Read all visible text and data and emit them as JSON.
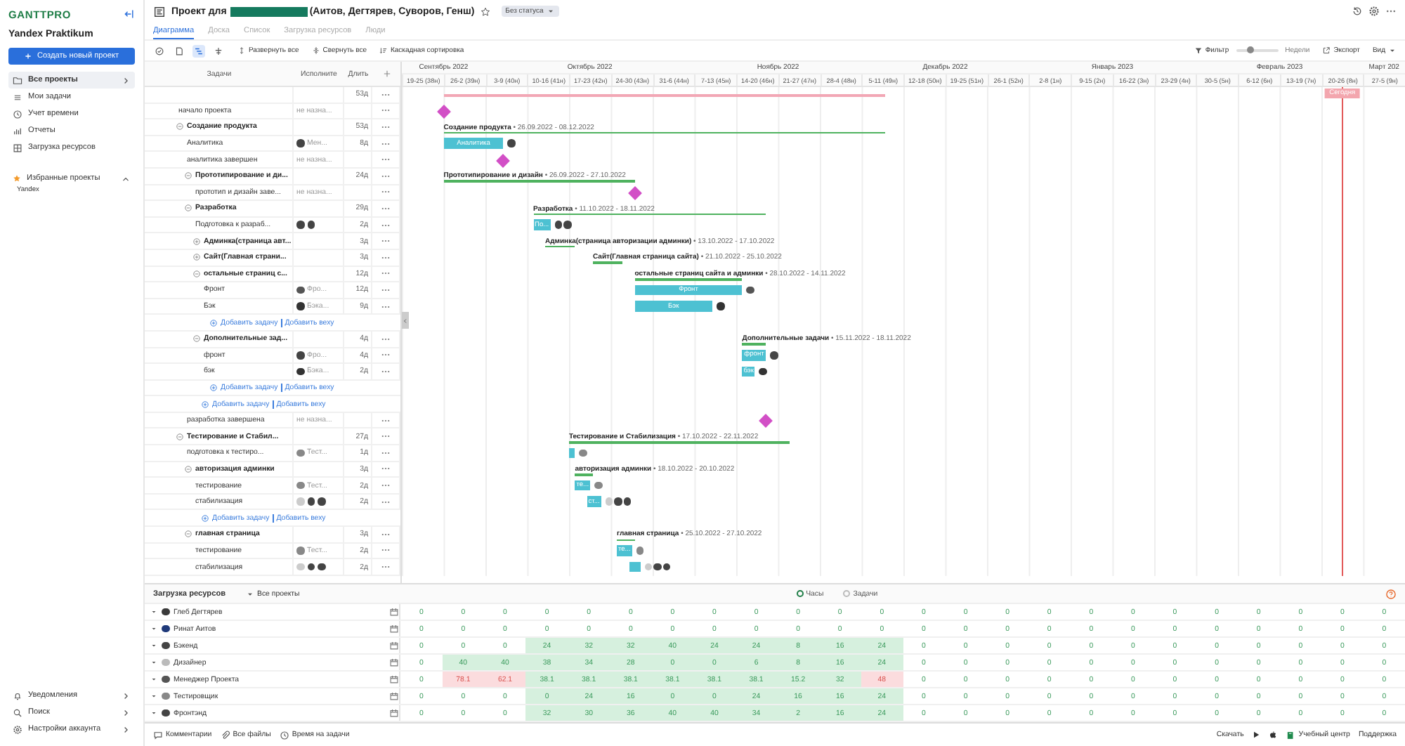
{
  "sidebar": {
    "logo": "GANTTPRO",
    "workspace": "Yandex Praktikum",
    "create_button": "Создать новый проект",
    "nav": [
      {
        "kind": "folder",
        "label": "Все проекты",
        "selected": true
      },
      {
        "kind": "list",
        "label": "Мои задачи",
        "selected": false
      },
      {
        "kind": "clock",
        "label": "Учет времени",
        "selected": false
      },
      {
        "kind": "chart",
        "label": "Отчеты",
        "selected": false
      },
      {
        "kind": "grid",
        "label": "Загрузка ресурсов",
        "selected": false
      }
    ],
    "favorites": {
      "title": "Избранные проекты",
      "expanded": true,
      "items": [
        "Yandex"
      ]
    },
    "bottom": [
      {
        "kind": "bell",
        "label": "Уведомления"
      },
      {
        "kind": "search",
        "label": "Поиск"
      },
      {
        "kind": "gear",
        "label": "Настройки аккаунта"
      }
    ]
  },
  "topbar": {
    "title_prefix": "Проект для",
    "title_suffix": "(Аитов, Дегтярев, Суворов, Генш)",
    "status": "Без статуса"
  },
  "tabs": [
    {
      "label": "Диаграмма",
      "selected": true
    },
    {
      "label": "Доска",
      "selected": false
    },
    {
      "label": "Список",
      "selected": false
    },
    {
      "label": "Загрузка ресурсов",
      "selected": false
    },
    {
      "label": "Люди",
      "selected": false
    }
  ],
  "toolbar": {
    "toggles": [
      {
        "kind": "check",
        "on": false
      },
      {
        "kind": "doc",
        "on": false
      },
      {
        "kind": "gantt",
        "on": true
      },
      {
        "kind": "split",
        "on": false
      }
    ],
    "actions": [
      {
        "kind": "expand",
        "label": "Развернуть все"
      },
      {
        "kind": "collapse",
        "label": "Свернуть все"
      },
      {
        "kind": "sort",
        "label": "Каскадная сортировка"
      }
    ],
    "filter": "Фильтр",
    "zoom": {
      "level": 0.35,
      "label": "Недели"
    },
    "export": "Экспорт",
    "view": "Вид"
  },
  "grid": {
    "columns": [
      "Задачи",
      "Исполните",
      "Длить"
    ]
  },
  "timeline": {
    "months": [
      {
        "label": "Сентябрь 2022",
        "weeks": [
          {
            "label": "19-25 (38н)",
            "today": false
          },
          {
            "label": "26-2 (39н)",
            "today": false
          }
        ]
      },
      {
        "label": "Октябрь 2022",
        "weeks": [
          {
            "label": "3-9 (40н)",
            "today": false
          },
          {
            "label": "10-16 (41н)",
            "today": false
          },
          {
            "label": "17-23 (42н)",
            "today": false
          },
          {
            "label": "24-30 (43н)",
            "today": false
          },
          {
            "label": "31-6 (44н)",
            "today": false
          }
        ]
      },
      {
        "label": "Ноябрь 2022",
        "weeks": [
          {
            "label": "7-13 (45н)",
            "today": false
          },
          {
            "label": "14-20 (46н)",
            "today": false
          },
          {
            "label": "21-27 (47н)",
            "today": false
          },
          {
            "label": "28-4 (48н)",
            "today": false
          }
        ]
      },
      {
        "label": "Декабрь 2022",
        "weeks": [
          {
            "label": "5-11 (49н)",
            "today": false
          },
          {
            "label": "12-18 (50н)",
            "today": false
          },
          {
            "label": "19-25 (51н)",
            "today": false
          },
          {
            "label": "26-1 (52н)",
            "today": false
          }
        ]
      },
      {
        "label": "Январь 2023",
        "weeks": [
          {
            "label": "2-8 (1н)",
            "today": false
          },
          {
            "label": "9-15 (2н)",
            "today": false
          },
          {
            "label": "16-22 (3н)",
            "today": false
          },
          {
            "label": "23-29 (4н)",
            "today": false
          }
        ]
      },
      {
        "label": "Февраль 2023",
        "weeks": [
          {
            "label": "30-5 (5н)",
            "today": false
          },
          {
            "label": "6-12 (6н)",
            "today": false
          },
          {
            "label": "13-19 (7н)",
            "today": false
          },
          {
            "label": "20-26 (8н)",
            "today": true
          }
        ]
      },
      {
        "label": "Март 202",
        "weeks": [
          {
            "label": "27-5 (9н)",
            "today": false
          }
        ]
      }
    ],
    "today_label": "Сегодня"
  },
  "tasks": [
    {
      "kind": "project",
      "duration": "53д",
      "children": [
        {
          "kind": "milestone",
          "name": "начало проекта",
          "assignee": "не назна..."
        },
        {
          "kind": "group",
          "name": "Создание продукта",
          "duration": "53д",
          "expanded": true,
          "bar": {
            "label": "Создание продукта",
            "dates": "• 26.09.2022 - 08.12.2022"
          },
          "children": [
            {
              "kind": "task",
              "name": "Аналитика",
              "assignee": "Мен...",
              "avatars": [
                {
                  "color": "#444444"
                }
              ],
              "duration": "8д",
              "bar": {
                "text": "Аналитика"
              }
            },
            {
              "kind": "milestone",
              "name": "аналитика завершен",
              "assignee": "не назна..."
            },
            {
              "kind": "group",
              "name": "Прототипирование и ди...",
              "duration": "24д",
              "expanded": true,
              "bar": {
                "label": "Прототипирование и дизайн",
                "dates": "• 26.09.2022 - 27.10.2022"
              },
              "children": [
                {
                  "kind": "milestone",
                  "name": "прототип и дизайн заве...",
                  "assignee": "не назна..."
                }
              ]
            },
            {
              "kind": "group",
              "name": "Разработка",
              "duration": "29д",
              "expanded": true,
              "bar": {
                "label": "Разработка",
                "dates": "• 11.10.2022 - 18.11.2022"
              },
              "children": [
                {
                  "kind": "task",
                  "name": "Подготовка к разраб...",
                  "avatars": [
                    {
                      "color": "#444444"
                    },
                    {
                      "color": "#444444"
                    }
                  ],
                  "duration": "2д",
                  "bar": {
                    "text": "По..."
                  }
                },
                {
                  "kind": "group",
                  "name": "Админка(страница авт...",
                  "duration": "3д",
                  "expanded": false,
                  "bar": {
                    "label": "Админка(страница авторизации админки)",
                    "dates": "• 13.10.2022 - 17.10.2022"
                  }
                },
                {
                  "kind": "group",
                  "name": "Сайт(Главная страни...",
                  "duration": "3д",
                  "expanded": false,
                  "bar": {
                    "label": "Сайт(Главная страница сайта)",
                    "dates": "• 21.10.2022 - 25.10.2022"
                  }
                },
                {
                  "kind": "group",
                  "name": "остальные страниц с...",
                  "duration": "12д",
                  "expanded": true,
                  "bar": {
                    "label": "остальные страниц сайта и админки",
                    "dates": "• 28.10.2022 - 14.11.2022"
                  },
                  "children": [
                    {
                      "kind": "task",
                      "name": "Фронт",
                      "assignee": "Фро...",
                      "avatars": [
                        {
                          "color": "#555555"
                        }
                      ],
                      "duration": "12д",
                      "bar": {
                        "text": "Фронт"
                      }
                    },
                    {
                      "kind": "task",
                      "name": "Бэк",
                      "assignee": "Бэка...",
                      "avatars": [
                        {
                          "color": "#333333"
                        }
                      ],
                      "duration": "9д",
                      "follows_previous": false,
                      "bar": {
                        "text": "Бэк"
                      }
                    },
                    {
                      "kind": "add",
                      "links": [
                        "Добавить задачу",
                        "Добавить веху"
                      ]
                    }
                  ]
                },
                {
                  "kind": "group",
                  "name": "Дополнительные зад...",
                  "duration": "4д",
                  "expanded": true,
                  "bar": {
                    "label": "Дополнительные задачи",
                    "dates": "• 15.11.2022 - 18.11.2022"
                  },
                  "children": [
                    {
                      "kind": "task",
                      "name": "фронт",
                      "assignee": "Фро...",
                      "avatars": [
                        {
                          "color": "#444444"
                        }
                      ],
                      "duration": "4д",
                      "bar": {
                        "text": "фронт"
                      }
                    },
                    {
                      "kind": "task",
                      "name": "бэк",
                      "assignee": "Бэка...",
                      "avatars": [
                        {
                          "color": "#333333"
                        }
                      ],
                      "duration": "2д",
                      "follows_previous": false,
                      "bar": {
                        "text": "бэк"
                      }
                    },
                    {
                      "kind": "add",
                      "links": [
                        "Добавить задачу",
                        "Добавить веху"
                      ]
                    }
                  ]
                },
                {
                  "kind": "add",
                  "links": [
                    "Добавить задачу",
                    "Добавить веху"
                  ]
                }
              ]
            },
            {
              "kind": "milestone",
              "name": "разработка завершена",
              "assignee": "не назна..."
            }
          ]
        },
        {
          "kind": "group",
          "name": "Тестирование и Стабил...",
          "duration": "27д",
          "expanded": true,
          "bar": {
            "label": "Тестирование и Стабилизация",
            "dates": "• 17.10.2022 - 22.11.2022"
          },
          "children": [
            {
              "kind": "task",
              "name": "подготовка к тестиро...",
              "assignee": "Тест...",
              "avatars": [
                {
                  "color": "#888888"
                }
              ],
              "duration": "1д"
            },
            {
              "kind": "group",
              "name": "авторизация админки",
              "duration": "3д",
              "expanded": true,
              "bar": {
                "label": "авторизация админки",
                "dates": "• 18.10.2022 - 20.10.2022"
              },
              "children": [
                {
                  "kind": "task",
                  "name": "тестирование",
                  "assignee": "Тест...",
                  "avatars": [
                    {
                      "color": "#888888"
                    }
                  ],
                  "duration": "2д",
                  "bar": {
                    "text": "те..."
                  }
                },
                {
                  "kind": "task",
                  "name": "стабилизация",
                  "avatars": [
                    {
                      "color": "#cccccc"
                    },
                    {
                      "color": "#444444"
                    },
                    {
                      "color": "#444444"
                    }
                  ],
                  "duration": "2д",
                  "follows_previous": true,
                  "bar": {
                    "text": "ст..."
                  }
                },
                {
                  "kind": "add",
                  "links": [
                    "Добавить задачу",
                    "Добавить веху"
                  ]
                }
              ]
            },
            {
              "kind": "group",
              "name": "главная страница",
              "duration": "3д",
              "expanded": true,
              "bar": {
                "label": "главная страница",
                "dates": "• 25.10.2022 - 27.10.2022"
              },
              "children": [
                {
                  "kind": "task",
                  "name": "тестирование",
                  "assignee": "Тест...",
                  "avatars": [
                    {
                      "color": "#888888"
                    }
                  ],
                  "duration": "2д",
                  "bar": {
                    "text": "те..."
                  }
                },
                {
                  "kind": "task",
                  "name": "стабилизация",
                  "avatars": [
                    {
                      "color": "#cccccc"
                    },
                    {
                      "color": "#444444"
                    },
                    {
                      "color": "#444444"
                    }
                  ],
                  "duration": "2д",
                  "follows_previous": true
                }
              ]
            }
          ]
        }
      ]
    }
  ],
  "resources": {
    "title": "Загрузка ресурсов",
    "filter": "Все проекты",
    "modes": [
      {
        "label": "Часы",
        "selected": true
      },
      {
        "label": "Задачи",
        "selected": false
      }
    ],
    "rows": [
      {
        "name": "Глеб Дегтярев",
        "color": "#3a3a3a",
        "hours": [
          "0",
          "0",
          "0",
          "0",
          "0",
          "0",
          "0",
          "0",
          "0",
          "0",
          "0",
          "0",
          "0",
          "0",
          "0",
          "0",
          "0",
          "0",
          "0",
          "0",
          "0",
          "0",
          "0",
          "0"
        ],
        "busy": [
          false,
          false,
          false,
          false,
          false,
          false,
          false,
          false,
          false,
          false,
          false,
          false,
          false,
          false,
          false,
          false,
          false,
          false,
          false,
          false,
          false,
          false,
          false,
          false
        ],
        "overloaded": [
          false,
          false,
          false,
          false,
          false,
          false,
          false,
          false,
          false,
          false,
          false,
          false,
          false,
          false,
          false,
          false,
          false,
          false,
          false,
          false,
          false,
          false,
          false,
          false
        ]
      },
      {
        "name": "Ринат Аитов",
        "color": "#1f3a7a",
        "hours": [
          "0",
          "0",
          "0",
          "0",
          "0",
          "0",
          "0",
          "0",
          "0",
          "0",
          "0",
          "0",
          "0",
          "0",
          "0",
          "0",
          "0",
          "0",
          "0",
          "0",
          "0",
          "0",
          "0",
          "0"
        ],
        "busy": [
          false,
          false,
          false,
          false,
          false,
          false,
          false,
          false,
          false,
          false,
          false,
          false,
          false,
          false,
          false,
          false,
          false,
          false,
          false,
          false,
          false,
          false,
          false,
          false
        ],
        "overloaded": [
          false,
          false,
          false,
          false,
          false,
          false,
          false,
          false,
          false,
          false,
          false,
          false,
          false,
          false,
          false,
          false,
          false,
          false,
          false,
          false,
          false,
          false,
          false,
          false
        ]
      },
      {
        "name": "Бэкенд",
        "color": "#444444",
        "hours": [
          "0",
          "0",
          "0",
          "24",
          "32",
          "32",
          "40",
          "24",
          "24",
          "8",
          "16",
          "24",
          "0",
          "0",
          "0",
          "0",
          "0",
          "0",
          "0",
          "0",
          "0",
          "0",
          "0",
          "0"
        ],
        "busy": [
          false,
          false,
          false,
          true,
          true,
          true,
          true,
          true,
          true,
          true,
          true,
          true,
          false,
          false,
          false,
          false,
          false,
          false,
          false,
          false,
          false,
          false,
          false,
          false
        ],
        "overloaded": [
          false,
          false,
          false,
          false,
          false,
          false,
          false,
          false,
          false,
          false,
          false,
          false,
          false,
          false,
          false,
          false,
          false,
          false,
          false,
          false,
          false,
          false,
          false,
          false
        ]
      },
      {
        "name": "Дизайнер",
        "color": "#bbbbbb",
        "hours": [
          "0",
          "40",
          "40",
          "38",
          "34",
          "28",
          "0",
          "0",
          "6",
          "8",
          "16",
          "24",
          "0",
          "0",
          "0",
          "0",
          "0",
          "0",
          "0",
          "0",
          "0",
          "0",
          "0",
          "0"
        ],
        "busy": [
          false,
          true,
          true,
          true,
          true,
          true,
          true,
          true,
          true,
          true,
          true,
          true,
          false,
          false,
          false,
          false,
          false,
          false,
          false,
          false,
          false,
          false,
          false,
          false
        ],
        "overloaded": [
          false,
          false,
          false,
          false,
          false,
          false,
          false,
          false,
          false,
          false,
          false,
          false,
          false,
          false,
          false,
          false,
          false,
          false,
          false,
          false,
          false,
          false,
          false,
          false
        ]
      },
      {
        "name": "Менеджер Проекта",
        "color": "#555555",
        "hours": [
          "0",
          "78.1",
          "62.1",
          "38.1",
          "38.1",
          "38.1",
          "38.1",
          "38.1",
          "38.1",
          "15.2",
          "32",
          "48",
          "0",
          "0",
          "0",
          "0",
          "0",
          "0",
          "0",
          "0",
          "0",
          "0",
          "0",
          "0"
        ],
        "busy": [
          false,
          true,
          true,
          true,
          true,
          true,
          true,
          true,
          true,
          true,
          true,
          true,
          false,
          false,
          false,
          false,
          false,
          false,
          false,
          false,
          false,
          false,
          false,
          false
        ],
        "overloaded": [
          false,
          true,
          true,
          false,
          false,
          false,
          false,
          false,
          false,
          false,
          false,
          true,
          false,
          false,
          false,
          false,
          false,
          false,
          false,
          false,
          false,
          false,
          false,
          false
        ]
      },
      {
        "name": "Тестировщик",
        "color": "#888888",
        "hours": [
          "0",
          "0",
          "0",
          "0",
          "24",
          "16",
          "0",
          "0",
          "24",
          "16",
          "16",
          "24",
          "0",
          "0",
          "0",
          "0",
          "0",
          "0",
          "0",
          "0",
          "0",
          "0",
          "0",
          "0"
        ],
        "busy": [
          false,
          false,
          false,
          true,
          true,
          true,
          true,
          true,
          true,
          true,
          true,
          true,
          false,
          false,
          false,
          false,
          false,
          false,
          false,
          false,
          false,
          false,
          false,
          false
        ],
        "overloaded": [
          false,
          false,
          false,
          false,
          false,
          false,
          false,
          false,
          false,
          false,
          false,
          false,
          false,
          false,
          false,
          false,
          false,
          false,
          false,
          false,
          false,
          false,
          false,
          false
        ]
      },
      {
        "name": "Фронтэнд",
        "color": "#444444",
        "hours": [
          "0",
          "0",
          "0",
          "32",
          "30",
          "36",
          "40",
          "40",
          "34",
          "2",
          "16",
          "24",
          "0",
          "0",
          "0",
          "0",
          "0",
          "0",
          "0",
          "0",
          "0",
          "0",
          "0",
          "0"
        ],
        "busy": [
          false,
          false,
          false,
          true,
          true,
          true,
          true,
          true,
          true,
          true,
          true,
          true,
          false,
          false,
          false,
          false,
          false,
          false,
          false,
          false,
          false,
          false,
          false,
          false
        ],
        "overloaded": [
          false,
          false,
          false,
          false,
          false,
          false,
          false,
          false,
          false,
          false,
          false,
          false,
          false,
          false,
          false,
          false,
          false,
          false,
          false,
          false,
          false,
          false,
          false,
          false
        ]
      }
    ]
  },
  "footer": {
    "left": [
      {
        "kind": "comment",
        "label": "Комментарии"
      },
      {
        "kind": "clip",
        "label": "Все файлы"
      },
      {
        "kind": "clock",
        "label": "Время на задачи"
      }
    ],
    "download": "Скачать",
    "academy": "Учебный центр",
    "support": "Поддержка"
  }
}
